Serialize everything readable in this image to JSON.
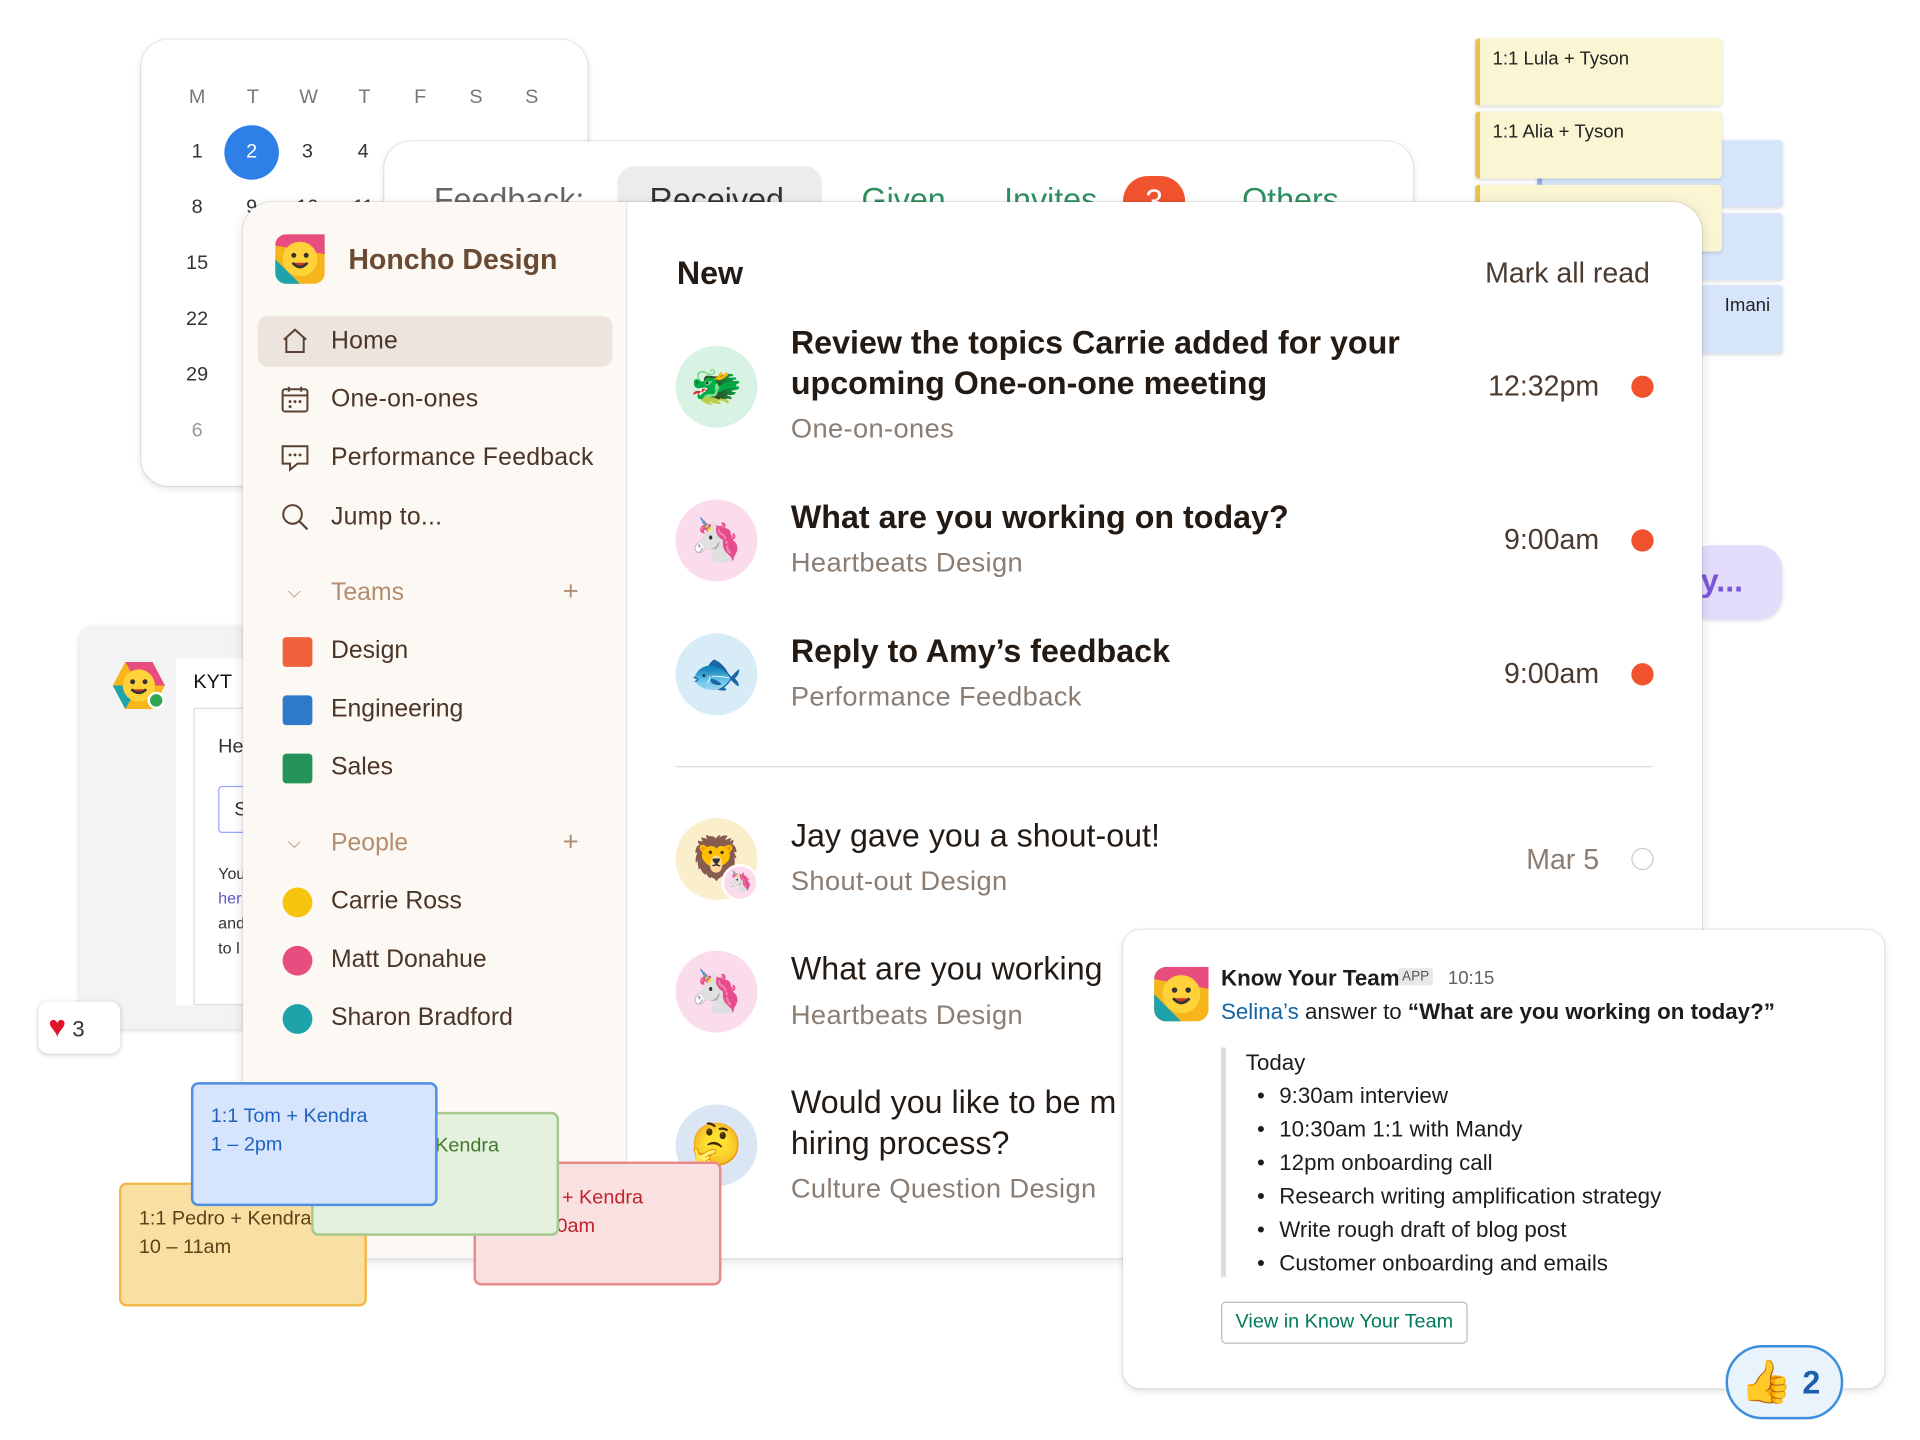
{
  "calendar": {
    "weekdays": [
      "M",
      "T",
      "W",
      "T",
      "F",
      "S",
      "S"
    ],
    "rows": [
      [
        "1",
        "2",
        "3",
        "4"
      ],
      [
        "8",
        "9",
        "10",
        "11"
      ],
      [
        "15"
      ],
      [
        "22"
      ],
      [
        "29"
      ],
      [
        "6"
      ]
    ],
    "selected": "2"
  },
  "feedback": {
    "label": "Feedback:",
    "tabs": [
      "Received",
      "Given",
      "Invites",
      "Others"
    ],
    "invites_count": "3"
  },
  "schedule": {
    "items": [
      "1:1 Lula + Tyson",
      "1:1 Alia + Tyson",
      "Imani"
    ],
    "pill_text": "y..."
  },
  "chat": {
    "app": "KYT",
    "snippets": [
      "He",
      "S",
      "You",
      "her",
      "and",
      "to l"
    ]
  },
  "reaction_heart": {
    "count": "3"
  },
  "sidebar": {
    "workspace": "Honcho Design",
    "nav": [
      {
        "label": "Home",
        "icon": "home-icon"
      },
      {
        "label": "One-on-ones",
        "icon": "calendar-icon"
      },
      {
        "label": "Performance Feedback",
        "icon": "speech-bubble-icon"
      },
      {
        "label": "Jump to...",
        "icon": "search-icon"
      }
    ],
    "teams_heading": "Teams",
    "teams": [
      {
        "name": "Design",
        "color": "#f2613e"
      },
      {
        "name": "Engineering",
        "color": "#2e79c9"
      },
      {
        "name": "Sales",
        "color": "#24935a"
      }
    ],
    "people_heading": "People",
    "people": [
      {
        "name": "Carrie Ross",
        "color": "#f6c30d"
      },
      {
        "name": "Matt Donahue",
        "color": "#e84d7f"
      },
      {
        "name": "Sharon Bradford",
        "color": "#1ea3ab"
      }
    ]
  },
  "feed": {
    "heading": "New",
    "mark_all": "Mark all read",
    "new_items": [
      {
        "title": "Review the topics Carrie added for your upcoming One-on-one meeting",
        "sub": "One-on-ones",
        "time": "12:32pm",
        "avatar": "🐲",
        "bg": "#d8f2e4"
      },
      {
        "title": "What are you working on today?",
        "sub": "Heartbeats  Design",
        "time": "9:00am",
        "avatar": "🦄",
        "bg": "#fbdcec"
      },
      {
        "title": "Reply to Amy’s feedback",
        "sub": "Performance Feedback",
        "time": "9:00am",
        "avatar": "🐟",
        "bg": "#d7ecf7"
      }
    ],
    "old_items": [
      {
        "title": "Jay gave you a shout-out!",
        "sub": "Shout-out  Design",
        "time": "Mar 5",
        "avatar": "🦁",
        "bg": "#fbeecb"
      },
      {
        "title": "What are you working",
        "sub": "Heartbeats  Design",
        "time": "",
        "avatar": "🦄",
        "bg": "#fbdcec"
      },
      {
        "title_l1": "Would you like to be m",
        "title_l2": "hiring process?",
        "sub": "Culture Question  Design",
        "time": "",
        "avatar": "🤔",
        "bg": "#dbe6f5"
      }
    ]
  },
  "slack": {
    "app": "Know Your Team",
    "badge": "APP",
    "time": "10:15",
    "name": "Selina’s",
    "answer_to": "answer to",
    "question": "“What are you working on today?”",
    "today": "Today",
    "bullets": [
      "9:30am interview",
      "10:30am 1:1 with Mandy",
      "12pm onboarding call",
      "Research writing amplification strategy",
      "Write rough draft of blog post",
      "Customer onboarding and emails"
    ],
    "button": "View in Know Your Team"
  },
  "meetings": [
    {
      "title": "1:1 Tom + Kendra",
      "time": "1 – 2pm"
    },
    {
      "title": "Kendra",
      "time": ""
    },
    {
      "title": "e + Kendra",
      "time": "10am"
    },
    {
      "title": "1:1 Pedro + Kendra",
      "time": "10 – 11am"
    }
  ],
  "thumbs": {
    "count": "2"
  }
}
